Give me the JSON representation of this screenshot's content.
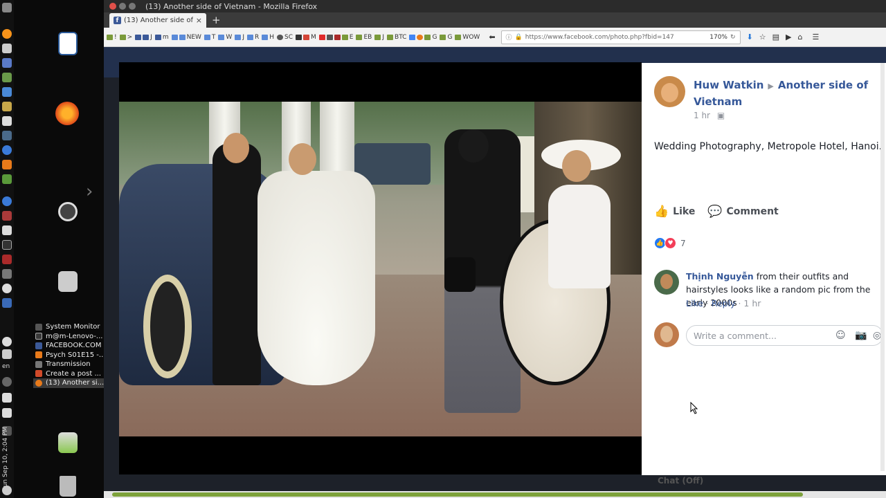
{
  "system": {
    "clock": "Sun Sep 10, 2:04 PM",
    "language": "en",
    "tasks": [
      {
        "label": "System Monitor",
        "color": "#555"
      },
      {
        "label": "m@m-Lenovo-...",
        "color": "#3a3a3a"
      },
      {
        "label": "FACEBOOK.COM",
        "color": "#3b5998"
      },
      {
        "label": "Psych S01E15 -...",
        "color": "#e87a1a"
      },
      {
        "label": "Transmission",
        "color": "#777"
      },
      {
        "label": "Create a post ...",
        "color": "#d04a2a"
      },
      {
        "label": "(13) Another si...",
        "color": "#e87a1a"
      }
    ]
  },
  "window": {
    "title": "(13) Another side of Vietnam - Mozilla Firefox",
    "tab_title": "(13) Another side of Vi",
    "url": "https://www.facebook.com/photo.php?fbid=147",
    "zoom": "170%"
  },
  "bookmarks": [
    "!",
    ">",
    "J",
    "m",
    "NEW",
    "T",
    "W",
    "J",
    "R",
    "H",
    "SC",
    "M",
    "E",
    "EB",
    "J",
    "BTC",
    "G",
    "G",
    "WOW"
  ],
  "post": {
    "author": "Huw Watkin",
    "group": "Another side of Vietnam",
    "time": "1 hr",
    "caption": "Wedding Photography, Metropole Hotel, Hanoi.",
    "like_label": "Like",
    "comment_label": "Comment",
    "reaction_count": "7"
  },
  "comment": {
    "name": "Thịnh Nguyễn",
    "text": "from their outfits and hairstyles looks like a random pic from the early 2000s",
    "like": "Like",
    "reply": "Reply",
    "time": "1 hr"
  },
  "reply_box": {
    "placeholder": "Write a comment..."
  },
  "chat": {
    "label": "Chat (Off)"
  }
}
